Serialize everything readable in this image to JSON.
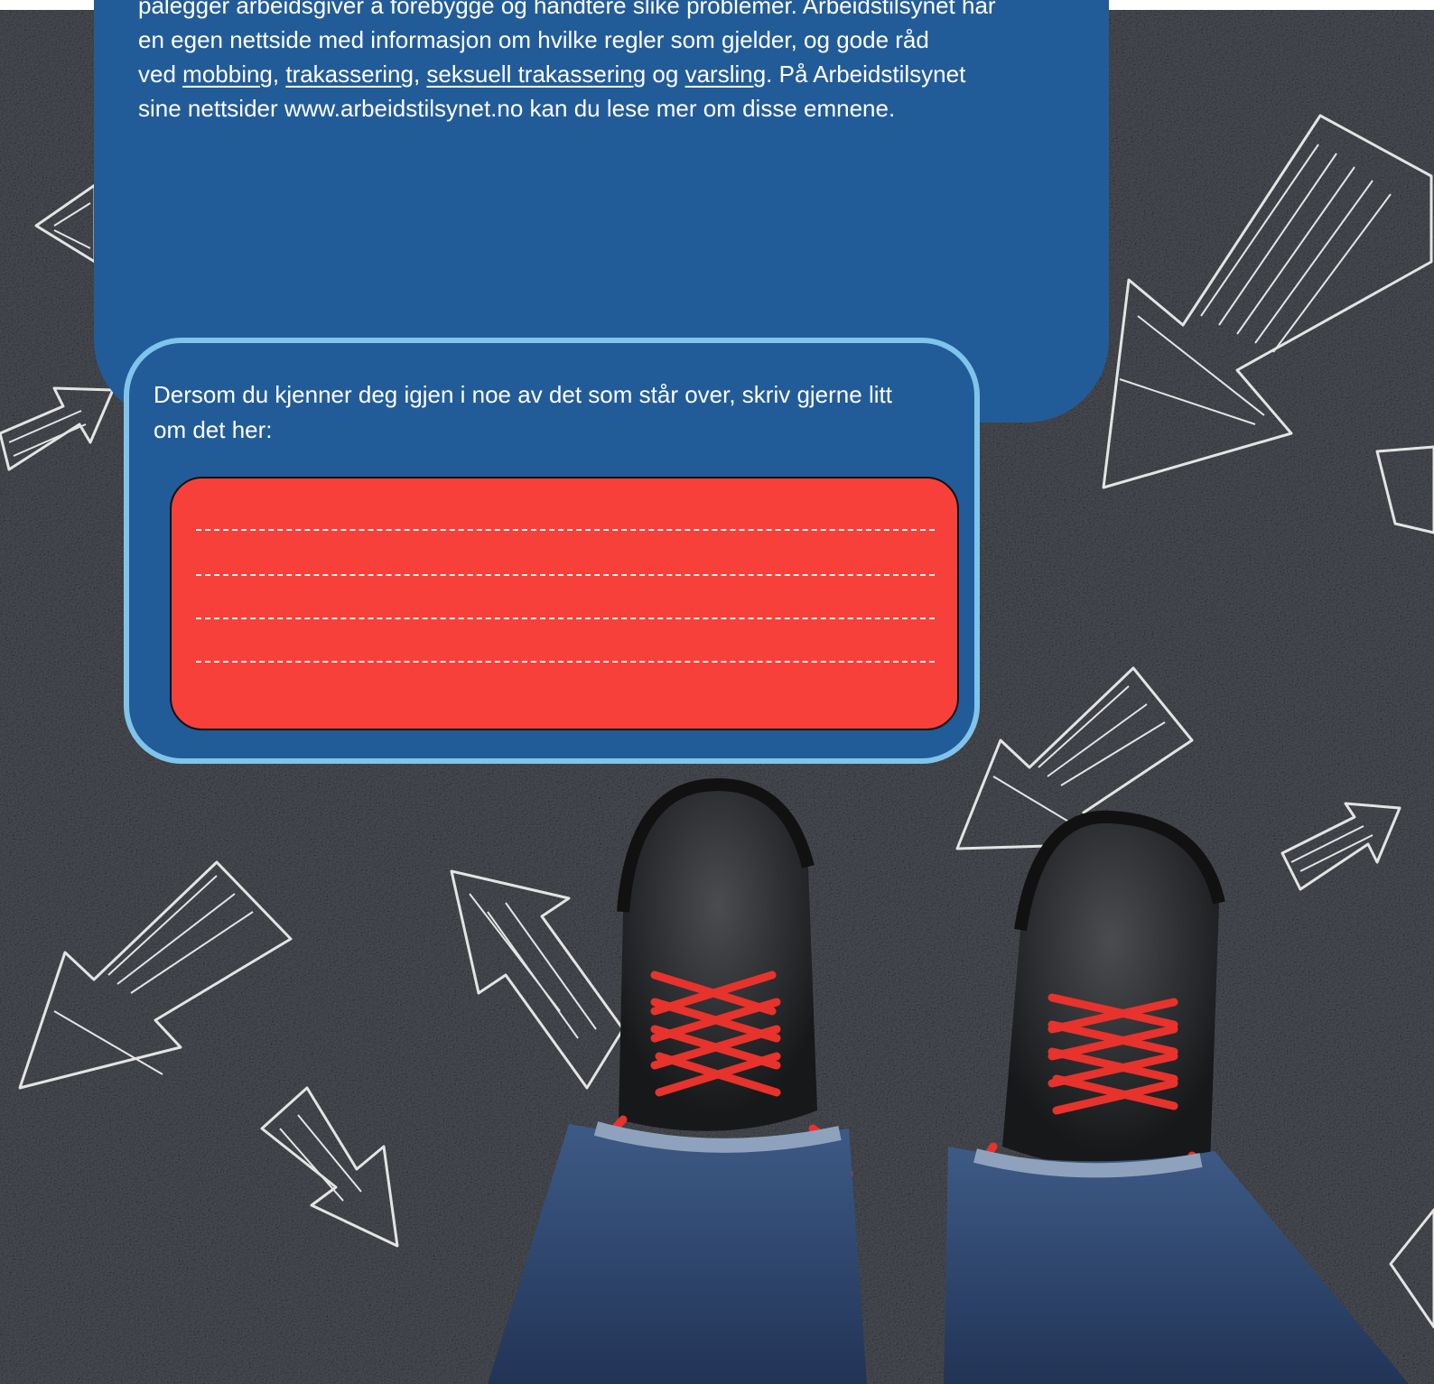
{
  "colors": {
    "info_panel": "#225c98",
    "card_border": "#7fc4ea",
    "answer_box": "#f7403a",
    "asphalt": "#2b2d31",
    "laces": "#e8322c"
  },
  "info": {
    "line1": "pålegger arbeidsgiver å forebygge og håndtere slike problemer. Arbeidstilsynet har",
    "line2": "en egen nettside med informasjon om hvilke regler som gjelder, og gode råd",
    "line3_prefix": "ved ",
    "link_mobbing": "mobbing",
    "sep1": ", ",
    "link_trakassering": "trakassering",
    "sep2": ", ",
    "link_seksuell": "seksuell trakassering",
    "and_word": " og ",
    "link_varsling": "varsling",
    "line3_suffix": ". På Arbeidstilsynet",
    "line4": "sine nettsider www.arbeidstilsynet.no kan du lese mer om disse emnene."
  },
  "form": {
    "prompt_line1": "Dersom du kjenner deg igjen i noe av det som står over, skriv gjerne litt",
    "prompt_line2": "om det her:",
    "answer_lines": 4
  },
  "background": {
    "icons": [
      "chalk-arrow-icon",
      "sneaker-icon"
    ]
  }
}
